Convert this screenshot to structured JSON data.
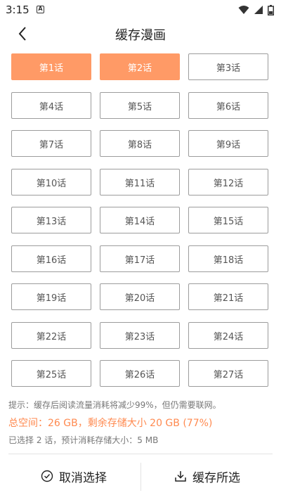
{
  "status_bar": {
    "time": "3:15",
    "notification_badge": "A",
    "icons": [
      "wifi-icon",
      "signal-icon",
      "battery-icon"
    ]
  },
  "header": {
    "title": "缓存漫画",
    "back_icon": "chevron-left-icon"
  },
  "colors": {
    "accent": "#ff9a66",
    "accent_text": "#ff8a50",
    "border": "#9c9c9c",
    "muted_text": "#777777"
  },
  "episodes": [
    {
      "label": "第1话",
      "selected": true
    },
    {
      "label": "第2话",
      "selected": true
    },
    {
      "label": "第3话",
      "selected": false
    },
    {
      "label": "第4话",
      "selected": false
    },
    {
      "label": "第5话",
      "selected": false
    },
    {
      "label": "第6话",
      "selected": false
    },
    {
      "label": "第7话",
      "selected": false
    },
    {
      "label": "第8话",
      "selected": false
    },
    {
      "label": "第9话",
      "selected": false
    },
    {
      "label": "第10话",
      "selected": false
    },
    {
      "label": "第11话",
      "selected": false
    },
    {
      "label": "第12话",
      "selected": false
    },
    {
      "label": "第13话",
      "selected": false
    },
    {
      "label": "第14话",
      "selected": false
    },
    {
      "label": "第15话",
      "selected": false
    },
    {
      "label": "第16话",
      "selected": false
    },
    {
      "label": "第17话",
      "selected": false
    },
    {
      "label": "第18话",
      "selected": false
    },
    {
      "label": "第19话",
      "selected": false
    },
    {
      "label": "第20话",
      "selected": false
    },
    {
      "label": "第21话",
      "selected": false
    },
    {
      "label": "第22话",
      "selected": false
    },
    {
      "label": "第23话",
      "selected": false
    },
    {
      "label": "第24话",
      "selected": false
    },
    {
      "label": "第25话",
      "selected": false
    },
    {
      "label": "第26话",
      "selected": false
    },
    {
      "label": "第27话",
      "selected": false
    }
  ],
  "info": {
    "hint": "提示：缓存后阅读流量消耗将减少99%，但仍需要联网。",
    "space": "总空间：26 GB，剩余存储大小 20 GB (77%)",
    "selection": "已选择 2 话，预计消耗存储大小：5 MB"
  },
  "bottom_bar": {
    "cancel_label": "取消选择",
    "cancel_icon": "check-circle-icon",
    "save_label": "缓存所选",
    "save_icon": "download-icon"
  }
}
